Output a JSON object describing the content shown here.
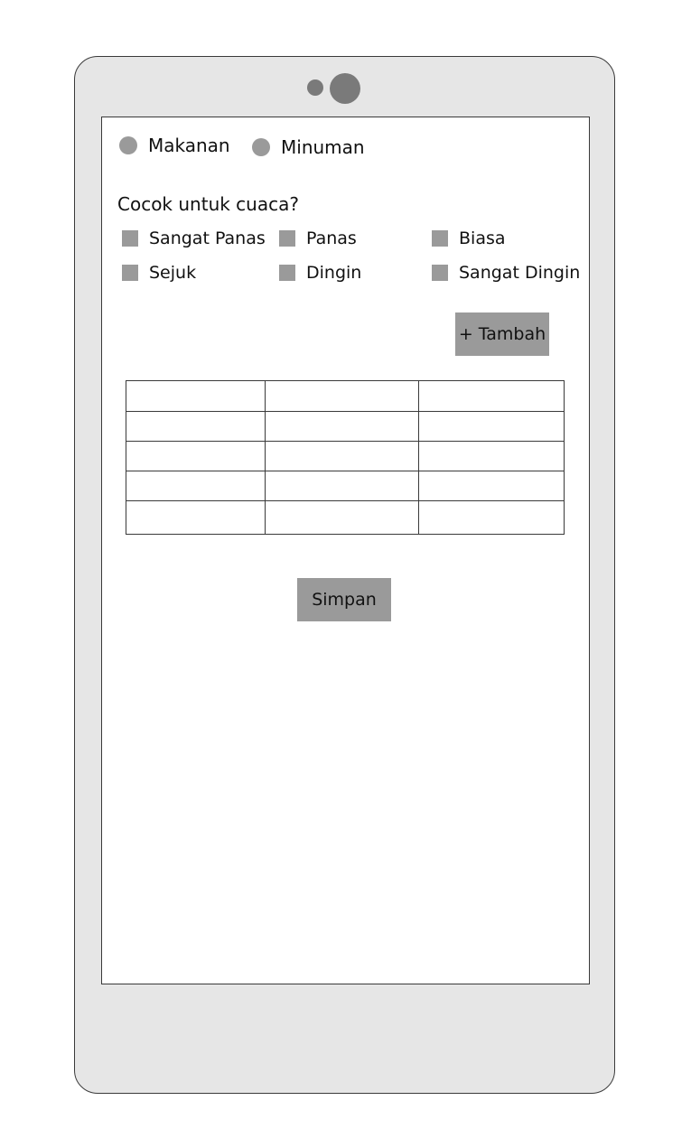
{
  "category_options": [
    {
      "label": "Makanan"
    },
    {
      "label": "Minuman"
    }
  ],
  "weather_question": "Cocok untuk cuaca?",
  "weather_options": [
    {
      "label": "Sangat Panas"
    },
    {
      "label": "Panas"
    },
    {
      "label": "Biasa"
    },
    {
      "label": "Sejuk"
    },
    {
      "label": "Dingin"
    },
    {
      "label": "Sangat Dingin"
    }
  ],
  "add_button_label": "+ Tambah",
  "table": {
    "columns": 3,
    "rows": [
      [
        "",
        "",
        ""
      ],
      [
        "",
        "",
        ""
      ],
      [
        "",
        "",
        ""
      ],
      [
        "",
        "",
        ""
      ],
      [
        "",
        "",
        ""
      ]
    ]
  },
  "save_button_label": "Simpan",
  "colors": {
    "device_body": "#e6e6e6",
    "control_fill": "#9a9a9a",
    "camera": "#7a7a7a",
    "outline": "#3a3a3a"
  }
}
